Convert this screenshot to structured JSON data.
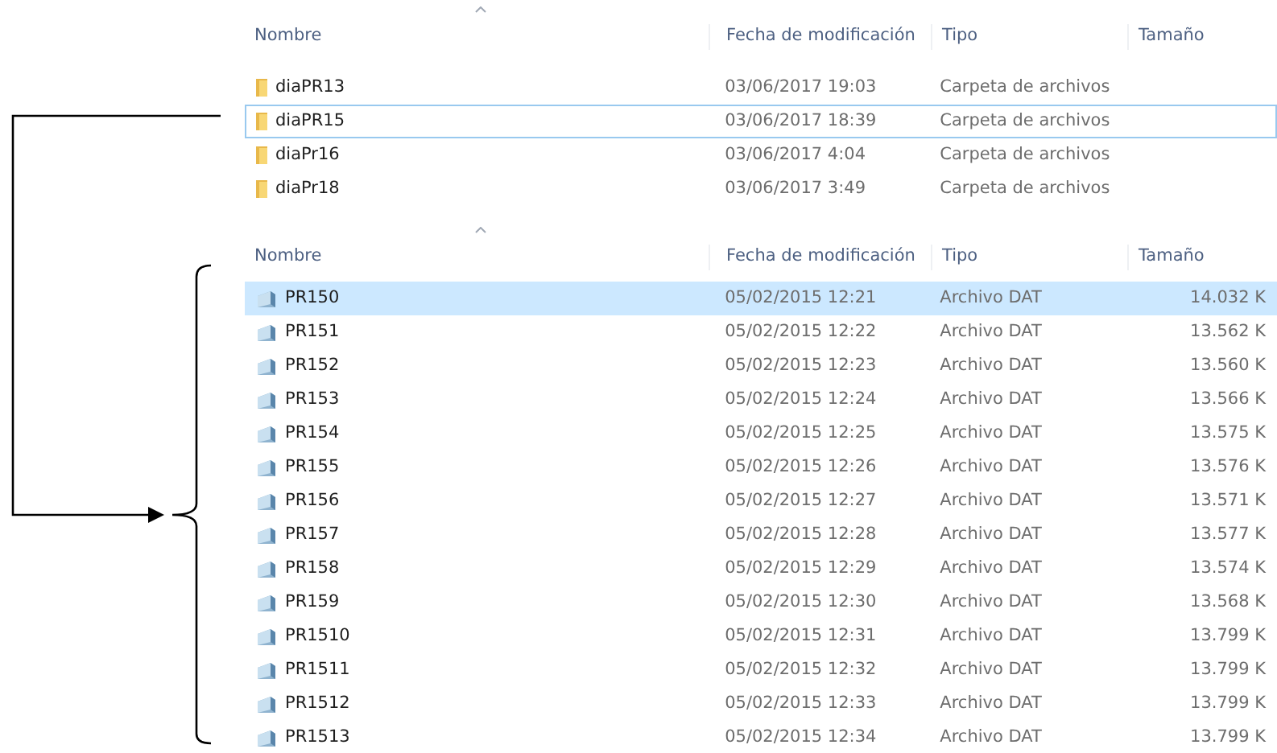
{
  "folder_list": {
    "columns": [
      "Nombre",
      "Fecha de modificación",
      "Tipo",
      "Tamaño"
    ],
    "rows": [
      {
        "kind": "folder",
        "name": "diaPR13",
        "modified": "03/06/2017 19:03",
        "type": "Carpeta de archivos",
        "focused": false
      },
      {
        "kind": "folder",
        "name": "diaPR15",
        "modified": "03/06/2017 18:39",
        "type": "Carpeta de archivos",
        "focused": true
      },
      {
        "kind": "folder",
        "name": "diaPr16",
        "modified": "03/06/2017 4:04",
        "type": "Carpeta de archivos",
        "focused": false
      },
      {
        "kind": "folder",
        "name": "diaPr18",
        "modified": "03/06/2017 3:49",
        "type": "Carpeta de archivos",
        "focused": false
      }
    ]
  },
  "file_list": {
    "columns": [
      "Nombre",
      "Fecha de modificación",
      "Tipo",
      "Tamaño"
    ],
    "rows": [
      {
        "kind": "file",
        "name": "PR150",
        "modified": "05/02/2015 12:21",
        "type": "Archivo DAT",
        "size": "14.032 K",
        "selected": true
      },
      {
        "kind": "file",
        "name": "PR151",
        "modified": "05/02/2015 12:22",
        "type": "Archivo DAT",
        "size": "13.562 K",
        "selected": false
      },
      {
        "kind": "file",
        "name": "PR152",
        "modified": "05/02/2015 12:23",
        "type": "Archivo DAT",
        "size": "13.560 K",
        "selected": false
      },
      {
        "kind": "file",
        "name": "PR153",
        "modified": "05/02/2015 12:24",
        "type": "Archivo DAT",
        "size": "13.566 K",
        "selected": false
      },
      {
        "kind": "file",
        "name": "PR154",
        "modified": "05/02/2015 12:25",
        "type": "Archivo DAT",
        "size": "13.575 K",
        "selected": false
      },
      {
        "kind": "file",
        "name": "PR155",
        "modified": "05/02/2015 12:26",
        "type": "Archivo DAT",
        "size": "13.576 K",
        "selected": false
      },
      {
        "kind": "file",
        "name": "PR156",
        "modified": "05/02/2015 12:27",
        "type": "Archivo DAT",
        "size": "13.571 K",
        "selected": false
      },
      {
        "kind": "file",
        "name": "PR157",
        "modified": "05/02/2015 12:28",
        "type": "Archivo DAT",
        "size": "13.577 K",
        "selected": false
      },
      {
        "kind": "file",
        "name": "PR158",
        "modified": "05/02/2015 12:29",
        "type": "Archivo DAT",
        "size": "13.574 K",
        "selected": false
      },
      {
        "kind": "file",
        "name": "PR159",
        "modified": "05/02/2015 12:30",
        "type": "Archivo DAT",
        "size": "13.568 K",
        "selected": false
      },
      {
        "kind": "file",
        "name": "PR1510",
        "modified": "05/02/2015 12:31",
        "type": "Archivo DAT",
        "size": "13.799 K",
        "selected": false
      },
      {
        "kind": "file",
        "name": "PR1511",
        "modified": "05/02/2015 12:32",
        "type": "Archivo DAT",
        "size": "13.799 K",
        "selected": false
      },
      {
        "kind": "file",
        "name": "PR1512",
        "modified": "05/02/2015 12:33",
        "type": "Archivo DAT",
        "size": "13.799 K",
        "selected": false
      },
      {
        "kind": "file",
        "name": "PR1513",
        "modified": "05/02/2015 12:34",
        "type": "Archivo DAT",
        "size": "13.799 K",
        "selected": false
      }
    ]
  }
}
